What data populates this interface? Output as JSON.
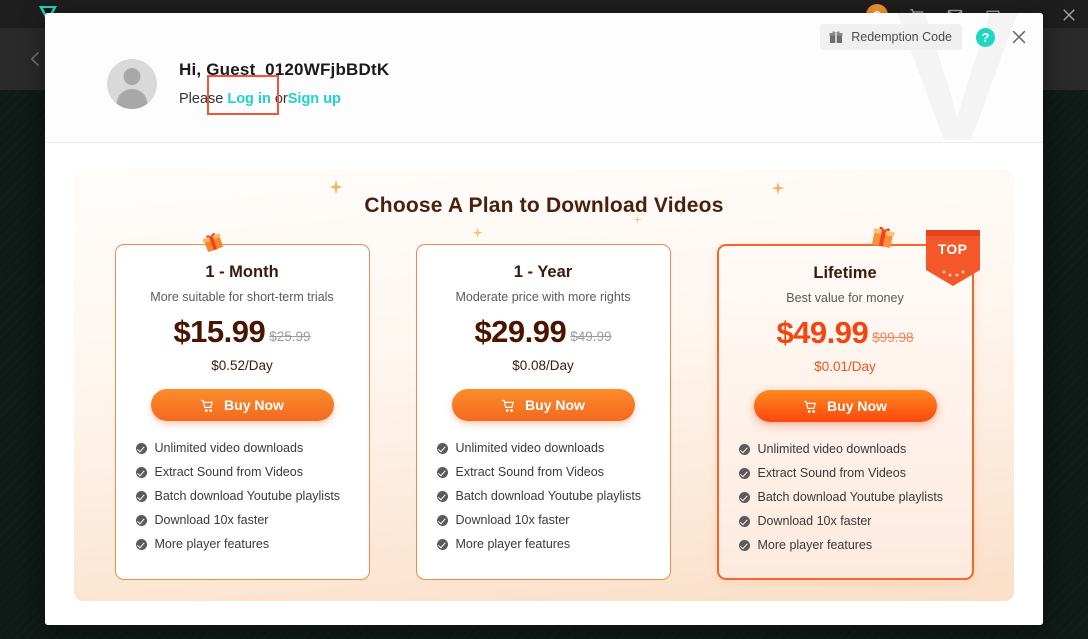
{
  "background": {
    "app_logo": "app-logo-icon",
    "titlebar_icons": [
      "orange-avatar-icon",
      "cart-icon",
      "mail-icon",
      "restore-icon",
      "minimize-icon",
      "close-icon"
    ],
    "back_arrow": "back-arrow-icon"
  },
  "modal": {
    "watermark": "V",
    "redemption": {
      "label": "Redemption Code",
      "icon": "gift-icon"
    },
    "help_icon_glyph": "?",
    "close_icon": "close-icon",
    "user": {
      "greeting": "Hi, Guest_0120WFjbBDtK",
      "prefix": "Please ",
      "login_label": "Log in",
      "between": " or ",
      "signup_label": "Sign up",
      "avatar": "user-avatar-icon"
    },
    "panel_title": "Choose A Plan to Download Videos",
    "colors": {
      "accent_orange": "#f4691f",
      "top_orange": "#f9470e",
      "link_teal": "#1ed6c3",
      "highlight_red": "#f4533b",
      "title_brown": "#4a1f0d"
    },
    "plans": [
      {
        "name": "1 - Month",
        "desc": "More suitable for short-term trials",
        "price": "$15.99",
        "old_price": "$25.99",
        "per_day": "$0.52/Day",
        "buy_label": "Buy Now",
        "badge": "",
        "features": [
          "Unlimited video downloads",
          "Extract Sound from Videos",
          "Batch download Youtube playlists",
          "Download 10x faster",
          "More player features"
        ]
      },
      {
        "name": "1 - Year",
        "desc": "Moderate price with more rights",
        "price": "$29.99",
        "old_price": "$49.99",
        "per_day": "$0.08/Day",
        "buy_label": "Buy Now",
        "badge": "",
        "features": [
          "Unlimited video downloads",
          "Extract Sound from Videos",
          "Batch download Youtube playlists",
          "Download 10x faster",
          "More player features"
        ]
      },
      {
        "name": "Lifetime",
        "desc": "Best value for money",
        "price": "$49.99",
        "old_price": "$99.98",
        "per_day": "$0.01/Day",
        "buy_label": "Buy Now",
        "badge": "TOP",
        "features": [
          "Unlimited video downloads",
          "Extract Sound from Videos",
          "Batch download Youtube playlists",
          "Download 10x faster",
          "More player features"
        ]
      }
    ]
  }
}
